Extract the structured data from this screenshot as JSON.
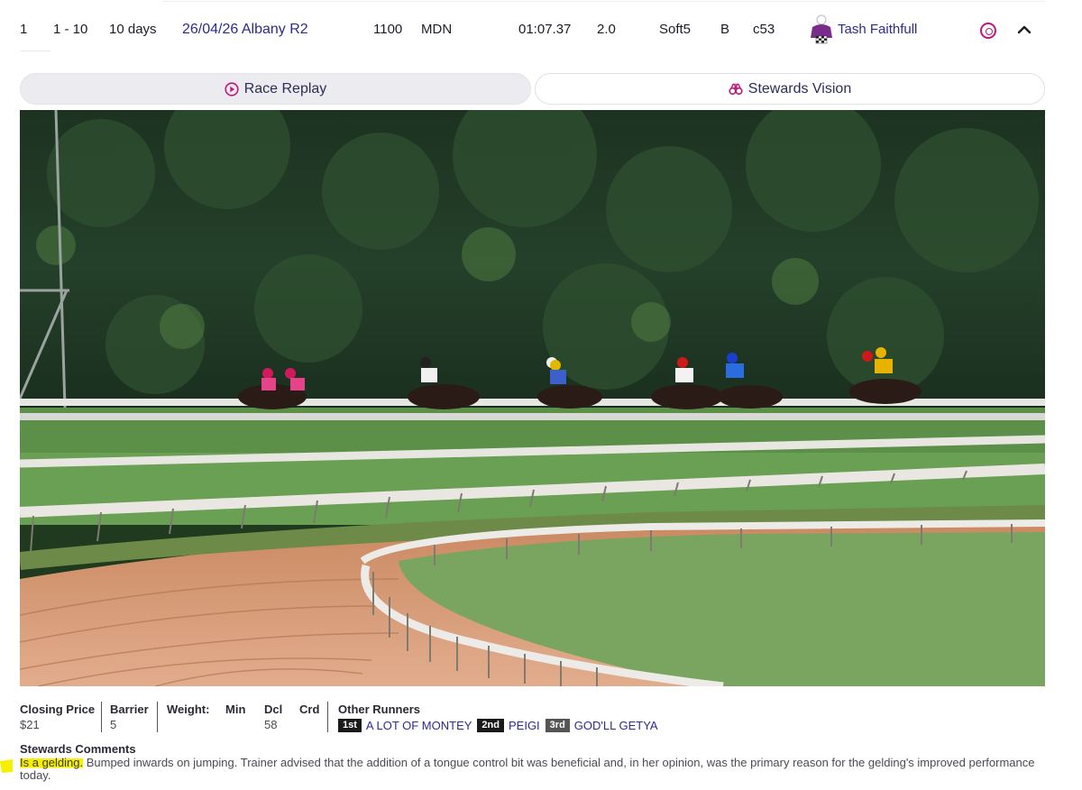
{
  "form_row": {
    "finish": "1",
    "range": "1 - 10",
    "days": "10 days",
    "race_link": "26/04/26 Albany R2",
    "distance": "1100",
    "class": "MDN",
    "time": "01:07.37",
    "margin": "2.0",
    "track": "Soft5",
    "gear": "B",
    "weight_code": "c53",
    "jockey": "Tash Faithfull"
  },
  "tabs": {
    "replay": "Race Replay",
    "stewards": "Stewards Vision"
  },
  "details": {
    "closing_price_label": "Closing Price",
    "closing_price": "$21",
    "barrier_label": "Barrier",
    "barrier": "5",
    "weight_label": "Weight:",
    "min_label": "Min",
    "dcl_label": "Dcl",
    "dcl": "58",
    "crd_label": "Crd",
    "other_runners_label": "Other Runners"
  },
  "other_runners": [
    {
      "pos": "1st",
      "name": "A LOT OF MONTEY"
    },
    {
      "pos": "2nd",
      "name": "PEIGI"
    },
    {
      "pos": "3rd",
      "name": "GOD'LL GETYA"
    }
  ],
  "stewards": {
    "title": "Stewards Comments",
    "highlight": "Is a gelding.",
    "comment": " Bumped inwards on jumping. Trainer advised that the addition of a tongue control bit was beneficial and, in her opinion, was the primary reason for the gelding's improved performance today."
  },
  "colors": {
    "link": "#2b2c8f",
    "accent": "#c0177e",
    "highlight": "#f6f000",
    "silks_primary": "#7b2c8a"
  },
  "icons": {
    "replay": "play-circle-icon",
    "stewards": "binoculars-icon",
    "silks": "jockey-silks-icon",
    "circle_action": "record-icon",
    "collapse": "chevron-up-icon"
  }
}
